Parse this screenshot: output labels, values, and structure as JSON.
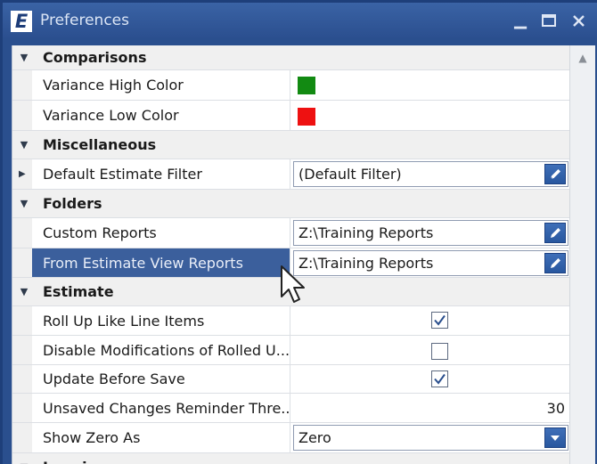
{
  "window": {
    "title": "Preferences",
    "app_icon_letter": "E"
  },
  "categories": {
    "comparisons": "Comparisons",
    "miscellaneous": "Miscellaneous",
    "folders": "Folders",
    "estimate": "Estimate",
    "logging": "Logging"
  },
  "properties": {
    "variance_high": {
      "name": "Variance High Color",
      "color": "#128a12"
    },
    "variance_low": {
      "name": "Variance Low Color",
      "color": "#ee1111"
    },
    "default_filter": {
      "name": "Default Estimate Filter",
      "value": "(Default Filter)"
    },
    "custom_reports": {
      "name": "Custom Reports",
      "value": "Z:\\Training Reports"
    },
    "from_estimate_reports": {
      "name": "From Estimate View Reports",
      "value": "Z:\\Training Reports"
    },
    "roll_up": {
      "name": "Roll Up Like Line Items",
      "checked": true
    },
    "disable_mods": {
      "name": "Disable Modifications of Rolled U...",
      "checked": false
    },
    "update_before_save": {
      "name": "Update Before Save",
      "checked": true
    },
    "unsaved_reminder": {
      "name": "Unsaved Changes Reminder Thre...",
      "value": "30"
    },
    "show_zero": {
      "name": "Show Zero As",
      "value": "Zero"
    }
  },
  "colors": {
    "titlebar": "#2b4f8f",
    "selection": "#3b5f9c",
    "button": "#28579f"
  },
  "icons": [
    "app-logo-icon",
    "minimize-icon",
    "maximize-icon",
    "close-icon",
    "pencil-icon",
    "dropdown-arrow-icon",
    "checkmark-icon",
    "expand-arrow-icon",
    "collapse-arrow-icon",
    "scroll-up-icon"
  ]
}
